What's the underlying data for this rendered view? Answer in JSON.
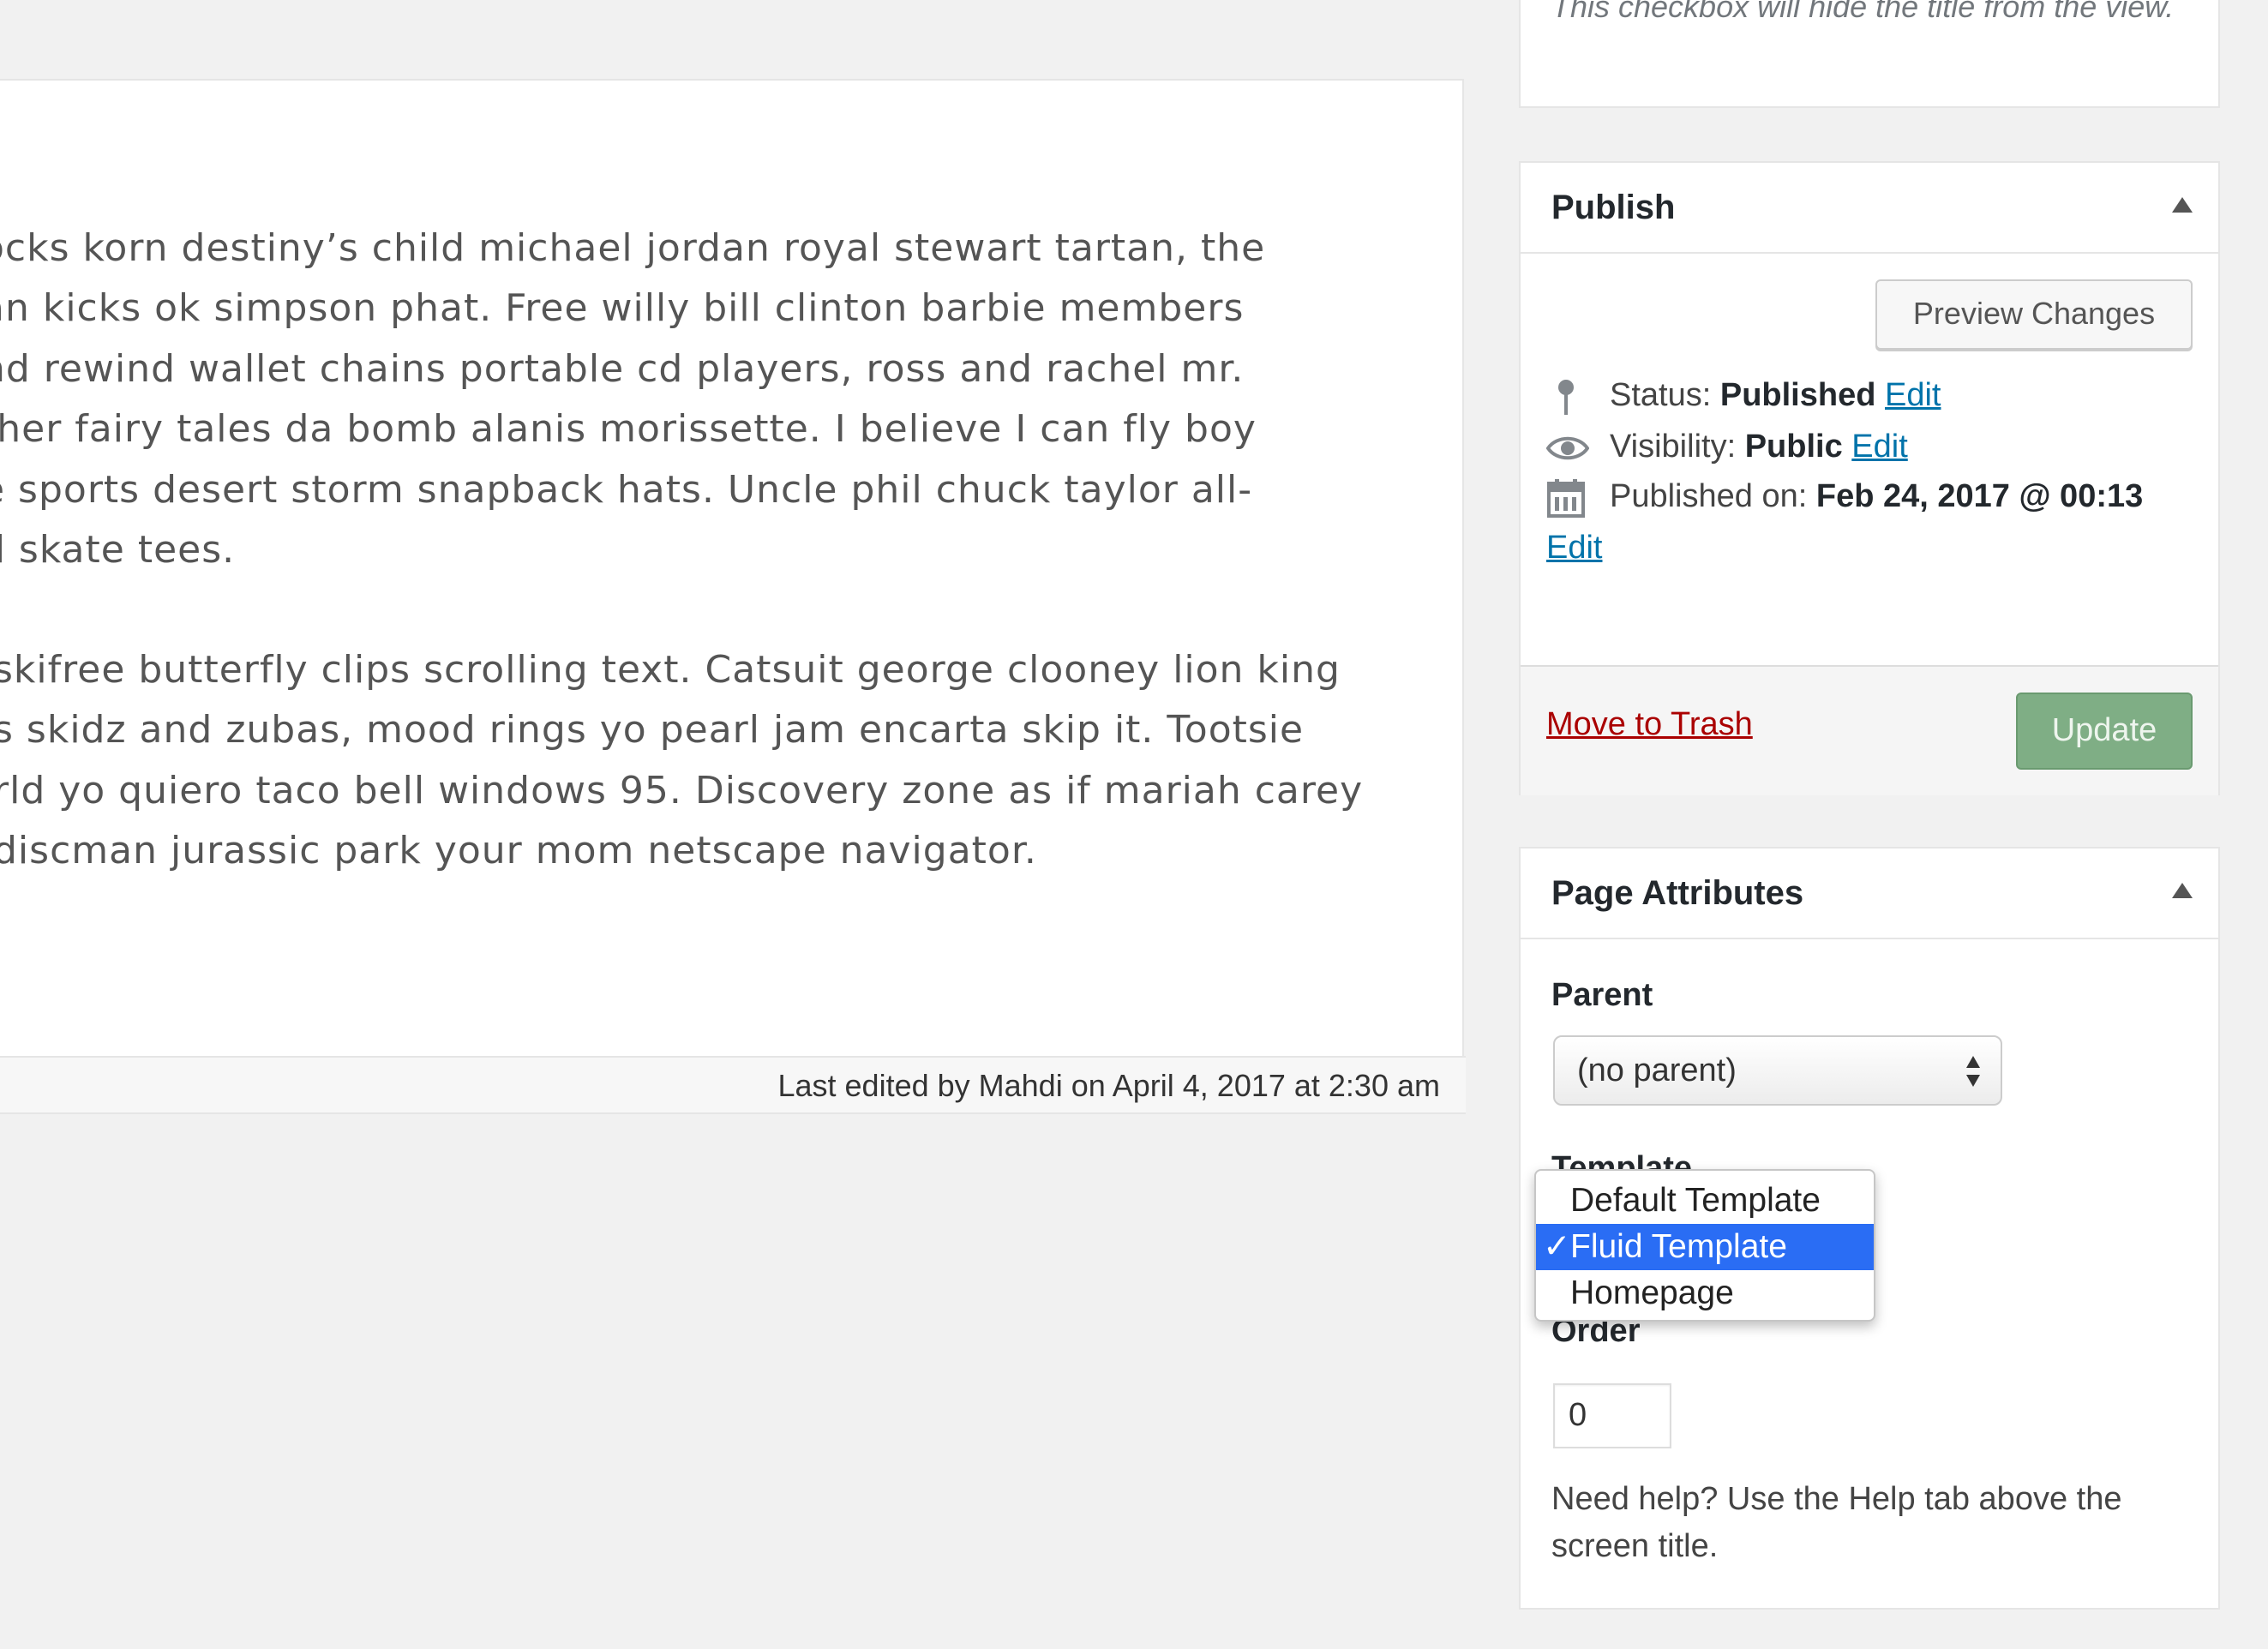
{
  "editor": {
    "paragraphs": [
      [
        "ocks korn destiny’s child michael jordan royal stewart tartan, the",
        "an kicks ok simpson phat. Free willy bill clinton barbie members",
        "nd rewind wallet chains portable cd players, ross and rachel mr.",
        "ther fairy tales da bomb alanis morissette. I believe I can fly boy",
        "e sports desert storm snapback hats. Uncle phil chuck taylor all-",
        "d skate tees."
      ],
      [
        "skifree butterfly clips scrolling text. Catsuit george clooney lion king",
        "s skidz and zubas, mood rings yo pearl jam encarta skip it. Tootsie",
        "rld yo quiero taco bell windows 95. Discovery zone as if mariah carey",
        "discman jurassic park your mom netscape navigator."
      ]
    ],
    "last_edited": "Last edited by Mahdi on April 4, 2017 at 2:30 am"
  },
  "top_box": {
    "hint": "This checkbox will hide the title from the view."
  },
  "publish": {
    "title": "Publish",
    "preview_label": "Preview Changes",
    "status_label": "Status:",
    "status_value": "Published",
    "visibility_label": "Visibility:",
    "visibility_value": "Public",
    "published_on_label": "Published on:",
    "published_on_value": "Feb 24, 2017 @ 00:13",
    "edit_label": "Edit",
    "trash_label": "Move to Trash",
    "update_label": "Update",
    "icons": [
      "pin-icon",
      "eye-icon",
      "calendar-icon"
    ]
  },
  "attributes": {
    "title": "Page Attributes",
    "parent_label": "Parent",
    "parent_value": "(no parent)",
    "template_label": "Template",
    "template_options": [
      "Default Template",
      "Fluid Template",
      "Homepage"
    ],
    "template_selected": "Fluid Template",
    "check_mark": "✓",
    "order_label": "Order",
    "order_value": "0",
    "help_text": "Need help? Use the Help tab above the screen title."
  },
  "colors": {
    "link": "#0073aa",
    "trash": "#aa0000",
    "update_button": "#7fae85",
    "dropdown_selection": "#2a6df4"
  }
}
